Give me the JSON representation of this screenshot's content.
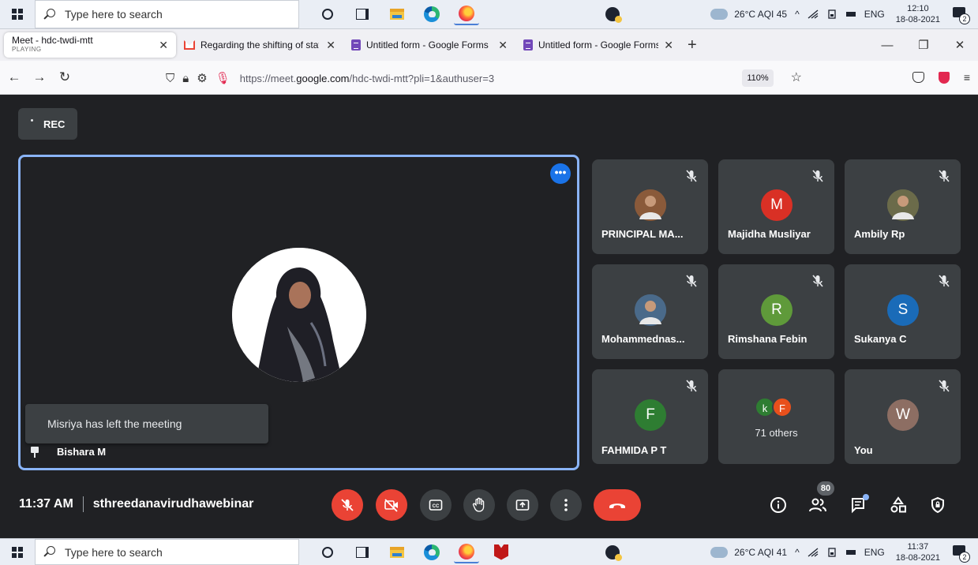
{
  "taskbar_top": {
    "search_placeholder": "Type here to search",
    "weather": "26°C  AQI 45",
    "lang": "ENG",
    "time": "12:10",
    "date": "18-08-2021",
    "notifications": "2"
  },
  "taskbar_bottom": {
    "search_placeholder": "Type here to search",
    "weather": "26°C  AQI 41",
    "lang": "ENG",
    "time": "11:37",
    "date": "18-08-2021",
    "notifications": "2"
  },
  "browser": {
    "tabs": [
      {
        "title": "Meet - hdc-twdi-mtt",
        "subtitle": "PLAYING",
        "icon": "meet-icon"
      },
      {
        "title": "Regarding the shifting of staff r",
        "icon": "gmail-icon"
      },
      {
        "title": "Untitled form - Google Forms",
        "icon": "forms-icon"
      },
      {
        "title": "Untitled form - Google Forms",
        "icon": "forms-icon"
      }
    ],
    "url_prefix": "https://meet.",
    "url_domain": "google.com",
    "url_path": "/hdc-twdi-mtt?pli=1&authuser=3",
    "zoom": "110%"
  },
  "meet": {
    "rec_label": "REC",
    "main_participant": "Bishara M",
    "toast": "Misriya has left the meeting",
    "tiles": [
      {
        "name": "PRINCIPAL MA...",
        "avatar": "photo",
        "color": "#8a5a3a"
      },
      {
        "name": "Majidha Musliyar",
        "avatar": "M",
        "color": "#d93025"
      },
      {
        "name": "Ambily Rp",
        "avatar": "photo",
        "color": "#6b6b4a"
      },
      {
        "name": "Mohammednas...",
        "avatar": "photo",
        "color": "#4a6a8a"
      },
      {
        "name": "Rimshana Febin",
        "avatar": "R",
        "color": "#5f9a3a"
      },
      {
        "name": "Sukanya C",
        "avatar": "S",
        "color": "#1a6bb8"
      },
      {
        "name": "FAHMIDA P T",
        "avatar": "F",
        "color": "#2e7d32"
      },
      {
        "name": "71 others",
        "avatar": "group",
        "color": "#3c4043"
      },
      {
        "name": "You",
        "avatar": "W",
        "color": "#8d6e63"
      }
    ],
    "others_avatars": [
      {
        "letter": "k",
        "color": "#2e7d32"
      },
      {
        "letter": "F",
        "color": "#e8501c"
      }
    ],
    "time": "11:37 AM",
    "meeting_name": "sthreedanavirudhawebinar",
    "participant_count": "80"
  }
}
